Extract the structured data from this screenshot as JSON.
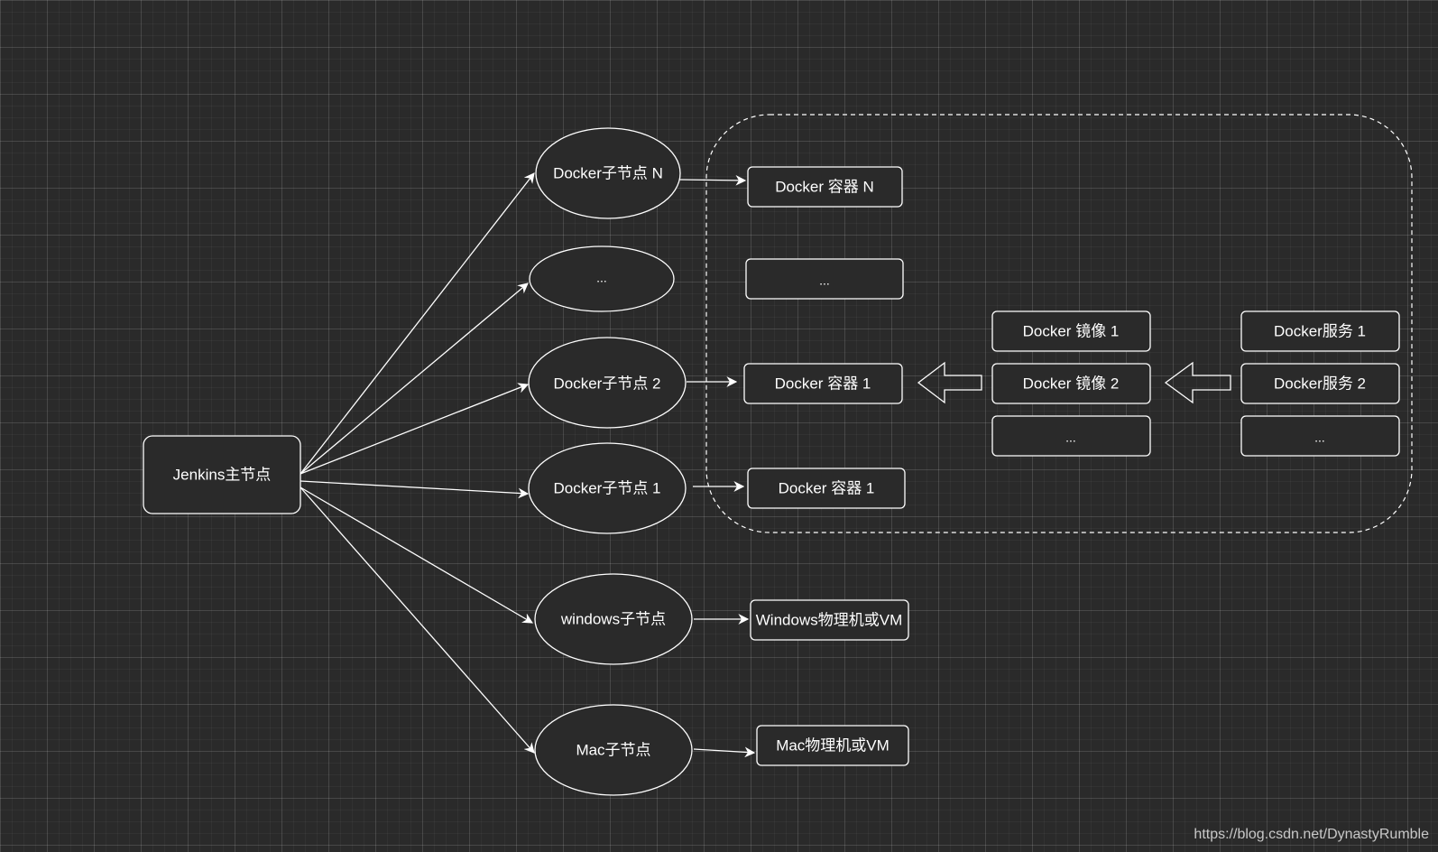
{
  "diagram": {
    "master": {
      "label": "Jenkins主节点"
    },
    "nodes": {
      "docker_n": "Docker子节点 N",
      "ellipsis": "...",
      "docker_2": "Docker子节点 2",
      "docker_1": "Docker子节点 1",
      "windows": "windows子节点",
      "mac": "Mac子节点"
    },
    "targets": {
      "container_n": "Docker 容器 N",
      "container_ellipsis": "...",
      "container_1_main": "Docker 容器 1",
      "container_1_lower": "Docker 容器  1",
      "windows_vm": "Windows物理机或VM",
      "mac_vm": "Mac物理机或VM"
    },
    "images": [
      "Docker 镜像 1",
      "Docker 镜像 2",
      "..."
    ],
    "services": [
      "Docker服务 1",
      "Docker服务 2",
      "..."
    ]
  },
  "watermark": "https://blog.csdn.net/DynastyRumble",
  "colors": {
    "background": "#2a2a2a",
    "stroke": "#ffffff",
    "fill": "#2a2a2a"
  }
}
